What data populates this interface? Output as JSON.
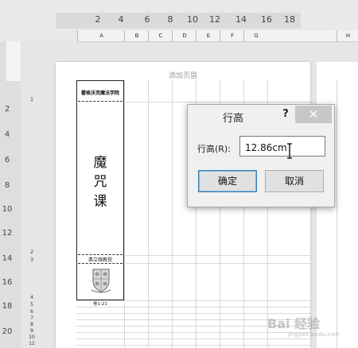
{
  "ruler_top": {
    "numbers": [
      "2",
      "4",
      "6",
      "8",
      "10",
      "12",
      "14",
      "16",
      "18"
    ]
  },
  "columns": [
    "A",
    "B",
    "C",
    "D",
    "E",
    "F",
    "G",
    "H"
  ],
  "ruler_left": {
    "numbers": [
      "2",
      "4",
      "6",
      "8",
      "10",
      "12",
      "14",
      "16",
      "18",
      "20"
    ]
  },
  "rows": [
    "1",
    "2",
    "3",
    "4",
    "5",
    "6",
    "7",
    "8",
    "9",
    "10",
    "11"
  ],
  "page": {
    "header_placeholder": "添加页眉"
  },
  "spine": {
    "school": "霍格沃茨魔法学院",
    "course": [
      "魔",
      "咒",
      "课"
    ],
    "author": "弗立维教授",
    "volume": "卷1-21"
  },
  "dialog": {
    "title": "行高",
    "help": "?",
    "close": "✕",
    "label": "行高(R):",
    "value": "12.86cm",
    "ok": "确定",
    "cancel": "取消"
  },
  "watermark": {
    "brand": "Bai 经验",
    "sub": "jingyan.baidu.com"
  },
  "colors": {
    "dialog_bg": "#f0f0f0",
    "ok_border": "#3c7fb1",
    "close_bg": "#c7c7c7"
  }
}
